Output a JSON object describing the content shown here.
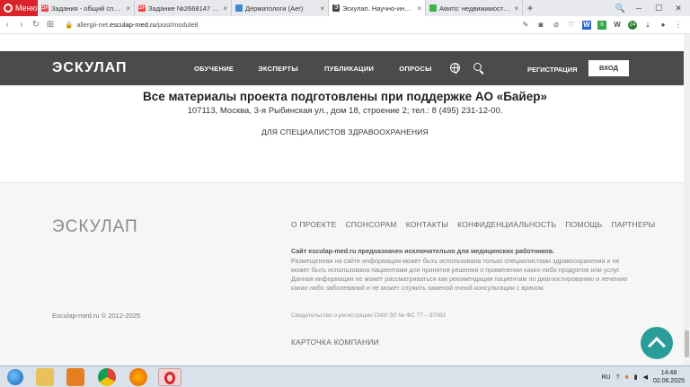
{
  "browser": {
    "menu_label": "Меню",
    "tabs": [
      {
        "title": "Задания - общий список",
        "favicon_color": "#e84a4a",
        "favicon_text": "SP",
        "active": false
      },
      {
        "title": "Задание №2668147 - про",
        "favicon_color": "#e84a4a",
        "favicon_text": "SP",
        "active": false
      },
      {
        "title": "Дерматологи (Aer)",
        "favicon_color": "#3a8ad6",
        "favicon_text": "",
        "active": false
      },
      {
        "title": "Эскулап. Научно-информ",
        "favicon_color": "#444444",
        "favicon_text": "Э",
        "active": true
      },
      {
        "title": "Авито: недвижимость, тра",
        "favicon_color": "#40b24a",
        "favicon_text": "",
        "active": false
      }
    ],
    "new_tab": "+",
    "url_prefix": "allergii-net.",
    "url_host": "esculap-med.ru",
    "url_path": "/post/module8",
    "ext_badges": [
      "W",
      "6",
      "W",
      "24"
    ]
  },
  "header": {
    "logo": "ЭСКУЛАП",
    "nav": [
      "ОБУЧЕНИЕ",
      "ЭКСПЕРТЫ",
      "ПУБЛИКАЦИИ",
      "ОПРОСЫ"
    ],
    "register": "РЕГИСТРАЦИЯ",
    "login": "ВХОД"
  },
  "content": {
    "support_title": "Все материалы проекта подготовлены при поддержке АО «Байер»",
    "support_address": "107113, Москва, 3-я Рыбинская ул., дом 18, строение 2; тел.: 8 (495) 231-12-00.",
    "specialists": "ДЛЯ СПЕЦИАЛИСТОВ ЗДРАВООХРАНЕНИЯ"
  },
  "footer": {
    "logo": "ЭСКУЛАП",
    "nav": [
      "О ПРОЕКТЕ",
      "СПОНСОРАМ",
      "КОНТАКТЫ",
      "КОНФИДЕНЦИАЛЬНОСТЬ",
      "ПОМОЩЬ",
      "ПАРТНЕРЫ"
    ],
    "note_title": "Сайт esculap-med.ru предназначен исключительно для медицинских работников.",
    "note_body": "Размещенная на сайте информация может быть использована только специалистами здравоохранения и не может быть использована пациентами для принятия решения о применении каких-либо продуктов или услуг. Данная информация не может рассматриваться как рекомендация пациентам по диагностированию и лечению каких-либо заболеваний и не может служить заменой очной консультации с врачом.",
    "copyright": "Esculap-med.ru © 2012-2025",
    "registration": "Свидетельство о регистрации СМИ ЭЛ № ФС 77 – 87083",
    "company_card": "КАРТОЧКА КОМПАНИИ"
  },
  "taskbar": {
    "lang": "RU",
    "time": "14:48",
    "date": "02.06.2025"
  }
}
